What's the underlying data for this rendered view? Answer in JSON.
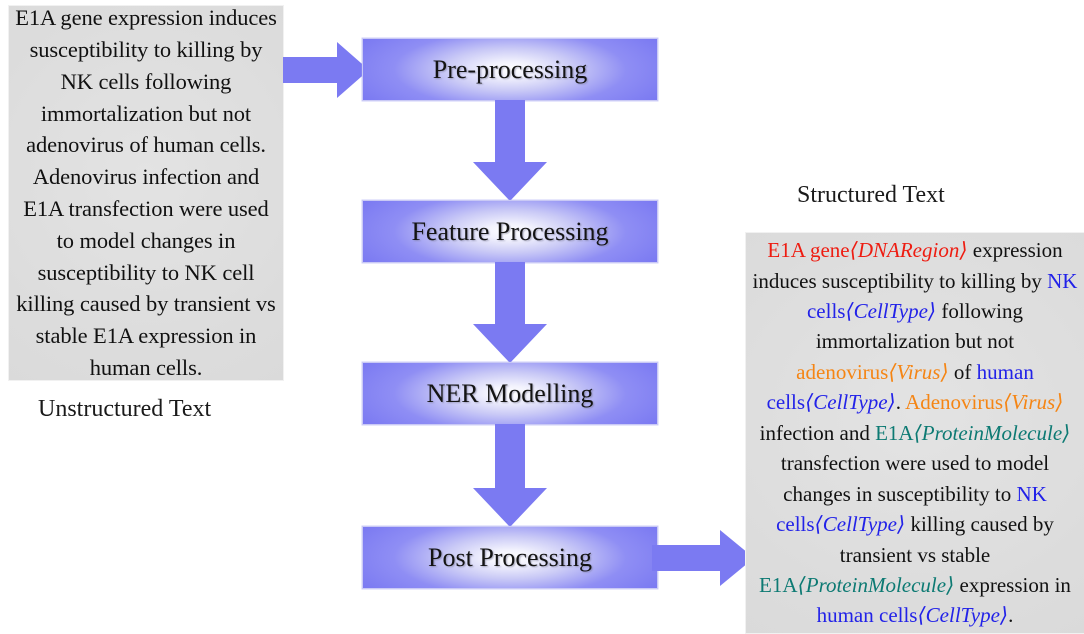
{
  "diagram": {
    "title": "NER pipeline: unstructured text to structured text",
    "accent_color": "#7b7af2",
    "panel_color": "#dcdcdc"
  },
  "unstructured": {
    "caption": "Unstructured Text",
    "text": "E1A gene expression induces susceptibility to killing by NK cells following immortalization but not adenovirus of human cells. Adenovirus infection and E1A transfection were used to model changes in susceptibility to NK cell killing caused by transient vs stable E1A expression in human cells."
  },
  "structured": {
    "caption": "Structured Text",
    "plain_text": "E1A gene⟨DNARegion⟩ expression induces susceptibility to killing by NK cells⟨CellType⟩ following immortalization but not adenovirus⟨Virus⟩ of human cells⟨CellType⟩. Adenovirus⟨Virus⟩ infection and E1A⟨ProteinMolecule⟩ transfection were used to model changes in susceptibility to NK cells⟨CellType⟩ killing caused by transient vs stable E1A⟨ProteinMolecule⟩ expression in human cells⟨CellType⟩.",
    "segments": [
      {
        "text": "E1A gene",
        "entity": "DNARegion",
        "color": "#ee1c11"
      },
      {
        "text": " expression induces susceptibility to killing by ",
        "entity": null,
        "color": "#111111"
      },
      {
        "text": "NK cells",
        "entity": "CellType",
        "color": "#2222e8"
      },
      {
        "text": " following immortalization but not ",
        "entity": null,
        "color": "#111111"
      },
      {
        "text": "adenovirus",
        "entity": "Virus",
        "color": "#f58514"
      },
      {
        "text": " of ",
        "entity": null,
        "color": "#111111"
      },
      {
        "text": "human cells",
        "entity": "CellType",
        "color": "#2222e8"
      },
      {
        "text": ". ",
        "entity": null,
        "color": "#111111"
      },
      {
        "text": "Adenovirus",
        "entity": "Virus",
        "color": "#f58514"
      },
      {
        "text": " infection and ",
        "entity": null,
        "color": "#111111"
      },
      {
        "text": "E1A",
        "entity": "ProteinMolecule",
        "color": "#0d7a73"
      },
      {
        "text": " transfection were used to model changes in susceptibility to ",
        "entity": null,
        "color": "#111111"
      },
      {
        "text": "NK cells",
        "entity": "CellType",
        "color": "#2222e8"
      },
      {
        "text": " killing caused by transient vs stable ",
        "entity": null,
        "color": "#111111"
      },
      {
        "text": "E1A",
        "entity": "ProteinMolecule",
        "color": "#0d7a73"
      },
      {
        "text": " expression in ",
        "entity": null,
        "color": "#111111"
      },
      {
        "text": "human cells",
        "entity": "CellType",
        "color": "#2222e8"
      },
      {
        "text": ".",
        "entity": null,
        "color": "#111111"
      }
    ],
    "entity_types": [
      {
        "name": "DNARegion",
        "color": "#ee1c11"
      },
      {
        "name": "CellType",
        "color": "#2222e8"
      },
      {
        "name": "Virus",
        "color": "#f58514"
      },
      {
        "name": "ProteinMolecule",
        "color": "#0d7a73"
      }
    ]
  },
  "pipeline": {
    "steps": [
      {
        "label": "Pre-processing"
      },
      {
        "label": "Feature Processing"
      },
      {
        "label": "NER Modelling"
      },
      {
        "label": "Post Processing"
      }
    ]
  },
  "arrows": {
    "input": "arrow-right",
    "between_1": "arrow-down",
    "between_2": "arrow-down",
    "between_3": "arrow-down",
    "output": "arrow-right"
  }
}
